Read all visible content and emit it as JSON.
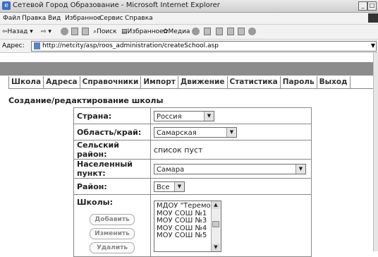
{
  "window": {
    "title": "Сетевой Город Образование - Microsoft Internet Explorer",
    "menu": [
      "Файл",
      "Правка",
      "Вид",
      "Избранное",
      "Сервис",
      "Справка"
    ],
    "toolbar": {
      "back": "Назад",
      "search": "Поиск",
      "favorites": "Избранное",
      "media": "Медиа"
    },
    "address_label": "Адрес:",
    "url": "http://netcity/asp/roos_administration/createSchool.asp"
  },
  "tabs": [
    "Школа",
    "Адреса",
    "Справочники",
    "Импорт",
    "Движение",
    "Статистика",
    "Пароль",
    "Выход"
  ],
  "heading": "Создание/редактирование школы",
  "form": {
    "country": {
      "label": "Страна:",
      "value": "Россия"
    },
    "region": {
      "label": "Область/край:",
      "value": "Самарская"
    },
    "rural_district": {
      "label": "Сельский район:",
      "value": "список пуст"
    },
    "locality": {
      "label": "Населенный пункт:",
      "value": "Самара"
    },
    "district": {
      "label": "Район:",
      "value": "Все"
    },
    "schools": {
      "label": "Школы:",
      "items": [
        "МДОУ \"Теремок\"",
        "МОУ СОШ №1",
        "МОУ СОШ №3",
        "МОУ СОШ №4",
        "МОУ СОШ №5"
      ],
      "buttons": {
        "add": "Добавить",
        "edit": "Изменить",
        "delete": "Удалить"
      }
    }
  }
}
